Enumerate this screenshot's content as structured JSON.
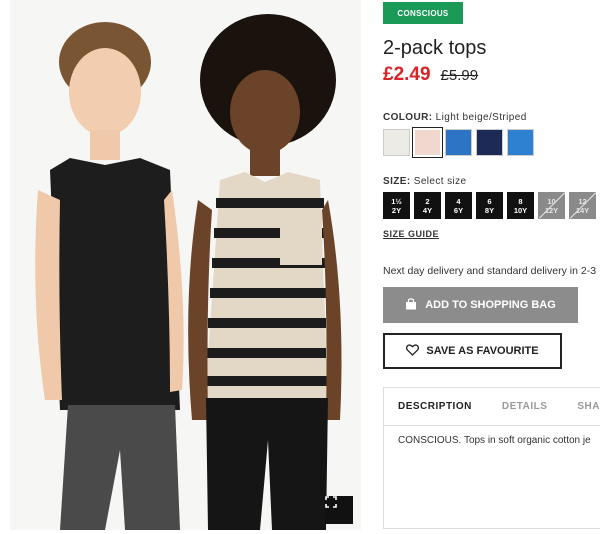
{
  "badge": "CONSCIOUS",
  "title": "2-pack tops",
  "price": {
    "current": "£2.49",
    "original": "£5.99"
  },
  "colour": {
    "label": "COLOUR:",
    "value": "Light beige/Striped",
    "swatches": [
      {
        "name": "white",
        "color": "#ecebe6"
      },
      {
        "name": "light-beige",
        "color": "#f0d8cf",
        "selected": true
      },
      {
        "name": "blue",
        "color": "#2d74c5"
      },
      {
        "name": "navy",
        "color": "#1d2a55"
      },
      {
        "name": "bright-blue",
        "color": "#2e80d0"
      }
    ]
  },
  "size": {
    "label": "SIZE:",
    "prompt": "Select size",
    "options": [
      {
        "top": "1½",
        "bottom": "2Y",
        "available": true
      },
      {
        "top": "2",
        "bottom": "4Y",
        "available": true
      },
      {
        "top": "4",
        "bottom": "6Y",
        "available": true
      },
      {
        "top": "6",
        "bottom": "8Y",
        "available": true
      },
      {
        "top": "8",
        "bottom": "10Y",
        "available": true
      },
      {
        "top": "10",
        "bottom": "12Y",
        "available": false
      },
      {
        "top": "12",
        "bottom": "14Y",
        "available": false
      }
    ],
    "guide": "SIZE GUIDE"
  },
  "delivery": "Next day delivery and standard delivery in 2-3",
  "buttons": {
    "add_to_bag": "ADD TO SHOPPING BAG",
    "favourite": "SAVE AS FAVOURITE"
  },
  "tabs": [
    {
      "label": "DESCRIPTION",
      "active": true
    },
    {
      "label": "DETAILS",
      "active": false
    },
    {
      "label": "SHA",
      "active": false
    }
  ],
  "description": "CONSCIOUS. Tops in soft organic cotton je",
  "colors": {
    "brand_green": "#1a9a56",
    "sale_red": "#d8232a",
    "disabled_button": "#8c8c8c"
  },
  "icons": [
    "fullscreen-icon",
    "shopping-bag-icon",
    "heart-icon"
  ]
}
